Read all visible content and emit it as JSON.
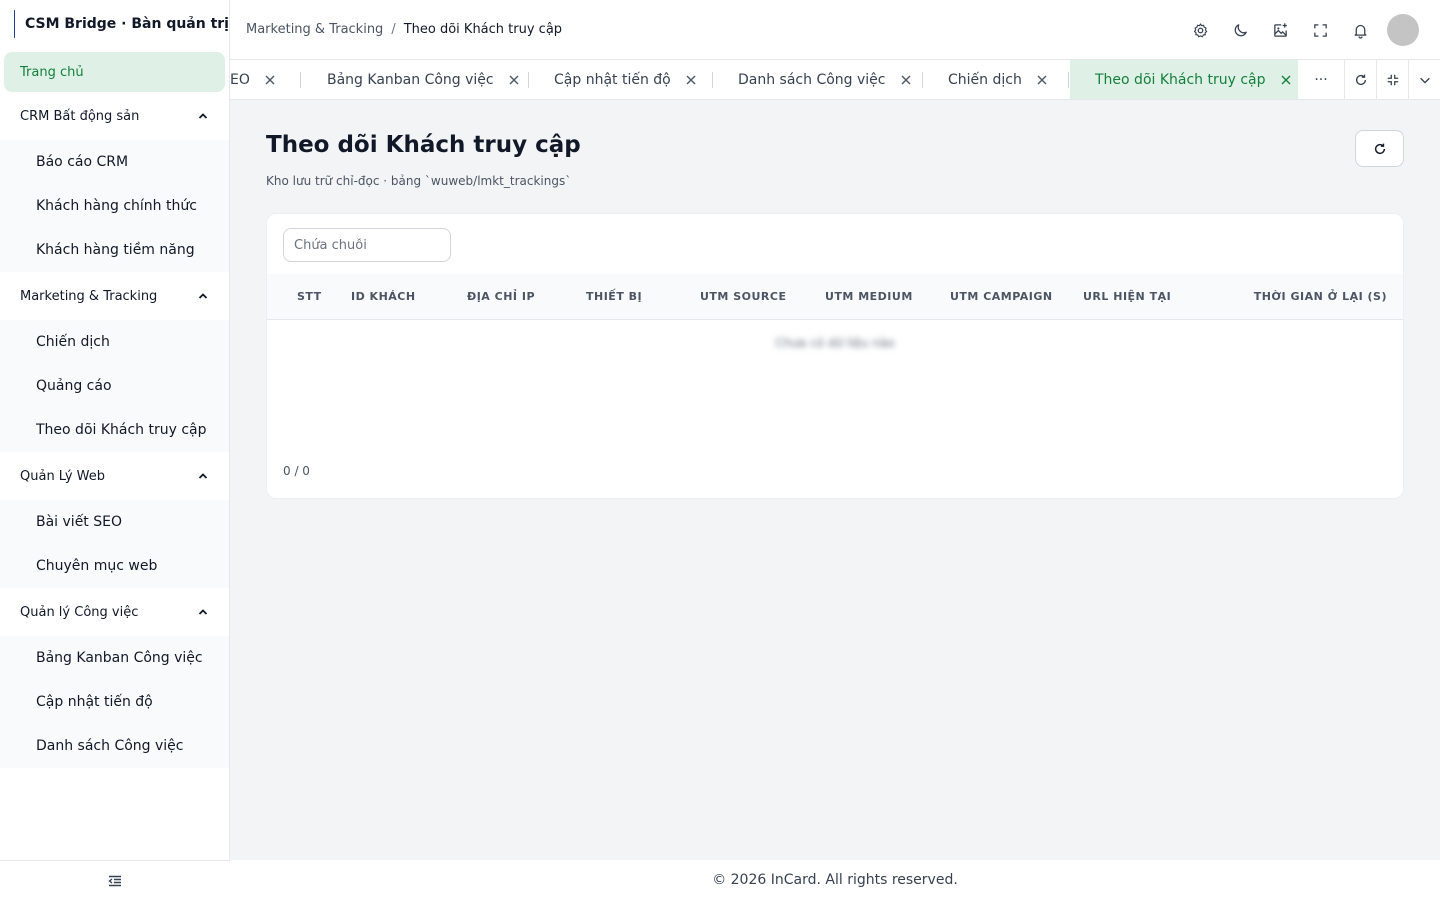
{
  "app": {
    "title": "CSM Bridge · Bàn quản trị",
    "logo_text": "CSM BRIDGE"
  },
  "sidebar": {
    "home": "Trang chủ",
    "groups": [
      {
        "label": "CRM Bất động sản",
        "items": [
          "Báo cáo CRM",
          "Khách hàng chính thức",
          "Khách hàng tiềm năng"
        ]
      },
      {
        "label": "Marketing & Tracking",
        "items": [
          "Chiến dịch",
          "Quảng cáo",
          "Theo dõi Khách truy cập"
        ]
      },
      {
        "label": "Quản Lý Web",
        "items": [
          "Bài viết SEO",
          "Chuyên mục web"
        ]
      },
      {
        "label": "Quản lý Công việc",
        "items": [
          "Bảng Kanban Công việc",
          "Cập nhật tiến độ",
          "Danh sách Công việc"
        ]
      }
    ]
  },
  "header": {
    "breadcrumb": [
      "Marketing & Tracking",
      "Theo dõi Khách truy cập"
    ],
    "separator": "/"
  },
  "tabs": {
    "items": [
      "EO",
      "Bảng Kanban Công việc",
      "Cập nhật tiến độ",
      "Danh sách Công việc",
      "Chiến dịch",
      "Theo dõi Khách truy cập"
    ],
    "active_index": 5,
    "more": "···"
  },
  "main": {
    "title": "Theo dõi Khách truy cập",
    "subtitle": "Kho lưu trữ chỉ-đọc · bảng `wuweb/lmkt_trackings`",
    "search_placeholder": "Chứa chuỗi",
    "columns": [
      "STT",
      "ID khách",
      "Địa chỉ IP",
      "Thiết bị",
      "UTM Source",
      "UTM Medium",
      "UTM Campaign",
      "URL hiện tại",
      "Thời gian ở lại (s)"
    ],
    "empty_text": "Chưa có dữ liệu nào",
    "pagination": "0 / 0"
  },
  "footer": {
    "text": "© 2026 InCard. All rights reserved."
  },
  "colors": {
    "accent": "#15803d",
    "accent_bg": "#dff1e6",
    "page_bg": "#f3f4f6"
  }
}
